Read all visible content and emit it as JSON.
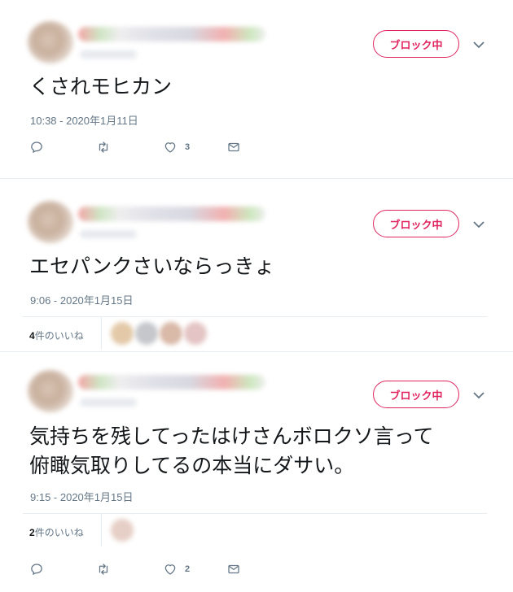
{
  "block_label": "ブロック中",
  "colors": {
    "block_accent": "#e0245e",
    "meta_text": "#657786"
  },
  "tweets": [
    {
      "text": "くされモヒカン",
      "timestamp": "10:38 - 2020年1月11日",
      "actions": {
        "reply_icon": "reply-icon",
        "retweet_icon": "retweet-icon",
        "like_count": "3",
        "dm_icon": "envelope-icon"
      }
    },
    {
      "text": "エセパンクさいならっきょ",
      "timestamp": "9:06 - 2020年1月15日",
      "likes": {
        "count": "4",
        "suffix": "件のいいね"
      }
    },
    {
      "text": "気持ちを残してったはけさんボロクソ言って\n俯瞰気取りしてるの本当にダサい。",
      "timestamp": "9:15 - 2020年1月15日",
      "likes": {
        "count": "2",
        "suffix": "件のいいね"
      },
      "actions": {
        "like_count": "2"
      }
    }
  ]
}
